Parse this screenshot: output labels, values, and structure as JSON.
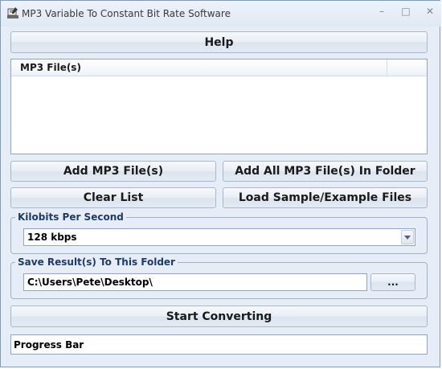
{
  "window": {
    "title": "MP3 Variable To Constant Bit Rate Software",
    "minimize_glyph": "–",
    "maximize_glyph": "□",
    "close_glyph": "✕"
  },
  "buttons": {
    "help": "Help",
    "add_files": "Add MP3 File(s)",
    "add_folder": "Add All MP3 File(s) In Folder",
    "clear_list": "Clear List",
    "load_sample": "Load Sample/Example Files",
    "browse": "...",
    "start": "Start Converting"
  },
  "file_list": {
    "column_header": "MP3 File(s)",
    "items": []
  },
  "kbps_group": {
    "label": "Kilobits Per Second",
    "selected": "128 kbps"
  },
  "save_group": {
    "label": "Save Result(s) To This Folder",
    "path": "C:\\Users\\Pete\\Desktop\\"
  },
  "progress": {
    "label": "Progress Bar",
    "value": 0
  },
  "icons": {
    "app": "mp3-app-icon",
    "dropdown": "chevron-down-icon"
  }
}
